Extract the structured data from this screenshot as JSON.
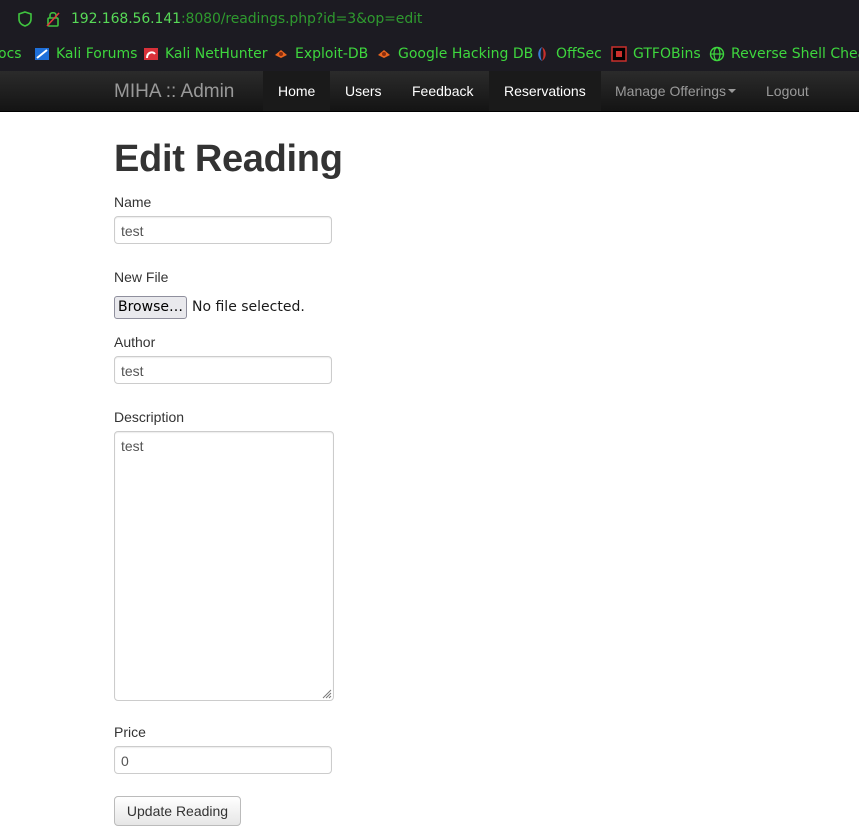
{
  "browser": {
    "url_host": "192.168.56.141",
    "url_rest": ":8080/readings.php?id=3&op=edit"
  },
  "bookmarks": [
    {
      "label": "ocs",
      "icon": "docs-icon"
    },
    {
      "label": "Kali Forums",
      "icon": "kali-forums-icon"
    },
    {
      "label": "Kali NetHunter",
      "icon": "kali-nethunter-icon"
    },
    {
      "label": "Exploit-DB",
      "icon": "exploit-db-icon"
    },
    {
      "label": "Google Hacking DB",
      "icon": "ghdb-icon"
    },
    {
      "label": "OffSec",
      "icon": "offsec-icon"
    },
    {
      "label": "GTFOBins",
      "icon": "gtfobins-icon"
    },
    {
      "label": "Reverse Shell Cheat",
      "icon": "globe-icon"
    }
  ],
  "navbar": {
    "brand": "MIHA :: Admin",
    "items": [
      {
        "label": "Home"
      },
      {
        "label": "Users"
      },
      {
        "label": "Feedback"
      },
      {
        "label": "Reservations"
      },
      {
        "label": "Manage Offerings"
      },
      {
        "label": "Logout"
      }
    ]
  },
  "form": {
    "title": "Edit Reading",
    "name_label": "Name",
    "name_value": "test",
    "file_label": "New File",
    "file_button": "Browse…",
    "file_status": "No file selected.",
    "author_label": "Author",
    "author_value": "test",
    "description_label": "Description",
    "description_value": "test",
    "price_label": "Price",
    "price_value": "0",
    "submit_label": "Update Reading"
  },
  "colors": {
    "url_green": "#3fc33f",
    "navbar_bg": "#1b1b1b",
    "text": "#333333"
  }
}
